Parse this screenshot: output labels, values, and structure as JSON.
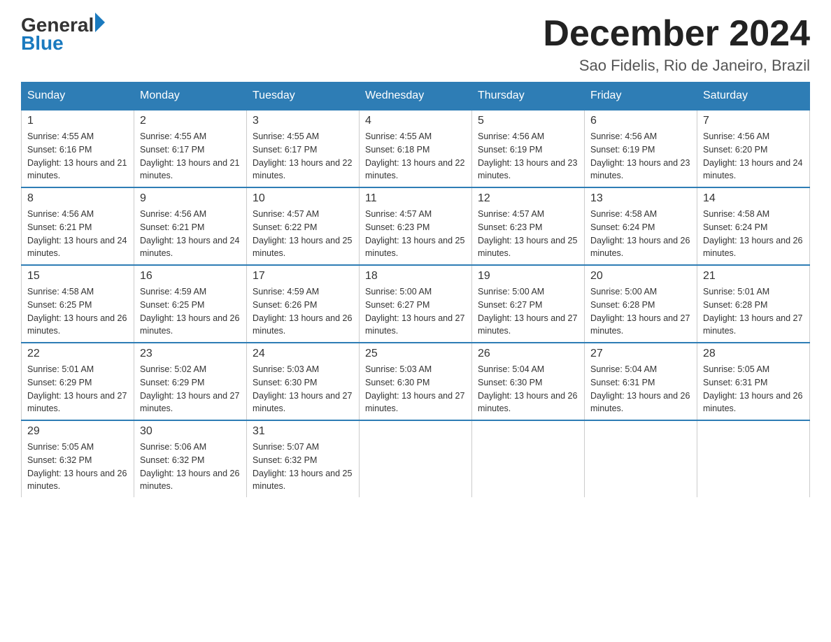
{
  "header": {
    "logo_general": "General",
    "logo_blue": "Blue",
    "title": "December 2024",
    "subtitle": "Sao Fidelis, Rio de Janeiro, Brazil"
  },
  "calendar": {
    "days_of_week": [
      "Sunday",
      "Monday",
      "Tuesday",
      "Wednesday",
      "Thursday",
      "Friday",
      "Saturday"
    ],
    "weeks": [
      [
        {
          "day": "1",
          "sunrise": "4:55 AM",
          "sunset": "6:16 PM",
          "daylight": "13 hours and 21 minutes."
        },
        {
          "day": "2",
          "sunrise": "4:55 AM",
          "sunset": "6:17 PM",
          "daylight": "13 hours and 21 minutes."
        },
        {
          "day": "3",
          "sunrise": "4:55 AM",
          "sunset": "6:17 PM",
          "daylight": "13 hours and 22 minutes."
        },
        {
          "day": "4",
          "sunrise": "4:55 AM",
          "sunset": "6:18 PM",
          "daylight": "13 hours and 22 minutes."
        },
        {
          "day": "5",
          "sunrise": "4:56 AM",
          "sunset": "6:19 PM",
          "daylight": "13 hours and 23 minutes."
        },
        {
          "day": "6",
          "sunrise": "4:56 AM",
          "sunset": "6:19 PM",
          "daylight": "13 hours and 23 minutes."
        },
        {
          "day": "7",
          "sunrise": "4:56 AM",
          "sunset": "6:20 PM",
          "daylight": "13 hours and 24 minutes."
        }
      ],
      [
        {
          "day": "8",
          "sunrise": "4:56 AM",
          "sunset": "6:21 PM",
          "daylight": "13 hours and 24 minutes."
        },
        {
          "day": "9",
          "sunrise": "4:56 AM",
          "sunset": "6:21 PM",
          "daylight": "13 hours and 24 minutes."
        },
        {
          "day": "10",
          "sunrise": "4:57 AM",
          "sunset": "6:22 PM",
          "daylight": "13 hours and 25 minutes."
        },
        {
          "day": "11",
          "sunrise": "4:57 AM",
          "sunset": "6:23 PM",
          "daylight": "13 hours and 25 minutes."
        },
        {
          "day": "12",
          "sunrise": "4:57 AM",
          "sunset": "6:23 PM",
          "daylight": "13 hours and 25 minutes."
        },
        {
          "day": "13",
          "sunrise": "4:58 AM",
          "sunset": "6:24 PM",
          "daylight": "13 hours and 26 minutes."
        },
        {
          "day": "14",
          "sunrise": "4:58 AM",
          "sunset": "6:24 PM",
          "daylight": "13 hours and 26 minutes."
        }
      ],
      [
        {
          "day": "15",
          "sunrise": "4:58 AM",
          "sunset": "6:25 PM",
          "daylight": "13 hours and 26 minutes."
        },
        {
          "day": "16",
          "sunrise": "4:59 AM",
          "sunset": "6:25 PM",
          "daylight": "13 hours and 26 minutes."
        },
        {
          "day": "17",
          "sunrise": "4:59 AM",
          "sunset": "6:26 PM",
          "daylight": "13 hours and 26 minutes."
        },
        {
          "day": "18",
          "sunrise": "5:00 AM",
          "sunset": "6:27 PM",
          "daylight": "13 hours and 27 minutes."
        },
        {
          "day": "19",
          "sunrise": "5:00 AM",
          "sunset": "6:27 PM",
          "daylight": "13 hours and 27 minutes."
        },
        {
          "day": "20",
          "sunrise": "5:00 AM",
          "sunset": "6:28 PM",
          "daylight": "13 hours and 27 minutes."
        },
        {
          "day": "21",
          "sunrise": "5:01 AM",
          "sunset": "6:28 PM",
          "daylight": "13 hours and 27 minutes."
        }
      ],
      [
        {
          "day": "22",
          "sunrise": "5:01 AM",
          "sunset": "6:29 PM",
          "daylight": "13 hours and 27 minutes."
        },
        {
          "day": "23",
          "sunrise": "5:02 AM",
          "sunset": "6:29 PM",
          "daylight": "13 hours and 27 minutes."
        },
        {
          "day": "24",
          "sunrise": "5:03 AM",
          "sunset": "6:30 PM",
          "daylight": "13 hours and 27 minutes."
        },
        {
          "day": "25",
          "sunrise": "5:03 AM",
          "sunset": "6:30 PM",
          "daylight": "13 hours and 27 minutes."
        },
        {
          "day": "26",
          "sunrise": "5:04 AM",
          "sunset": "6:30 PM",
          "daylight": "13 hours and 26 minutes."
        },
        {
          "day": "27",
          "sunrise": "5:04 AM",
          "sunset": "6:31 PM",
          "daylight": "13 hours and 26 minutes."
        },
        {
          "day": "28",
          "sunrise": "5:05 AM",
          "sunset": "6:31 PM",
          "daylight": "13 hours and 26 minutes."
        }
      ],
      [
        {
          "day": "29",
          "sunrise": "5:05 AM",
          "sunset": "6:32 PM",
          "daylight": "13 hours and 26 minutes."
        },
        {
          "day": "30",
          "sunrise": "5:06 AM",
          "sunset": "6:32 PM",
          "daylight": "13 hours and 26 minutes."
        },
        {
          "day": "31",
          "sunrise": "5:07 AM",
          "sunset": "6:32 PM",
          "daylight": "13 hours and 25 minutes."
        },
        null,
        null,
        null,
        null
      ]
    ]
  }
}
